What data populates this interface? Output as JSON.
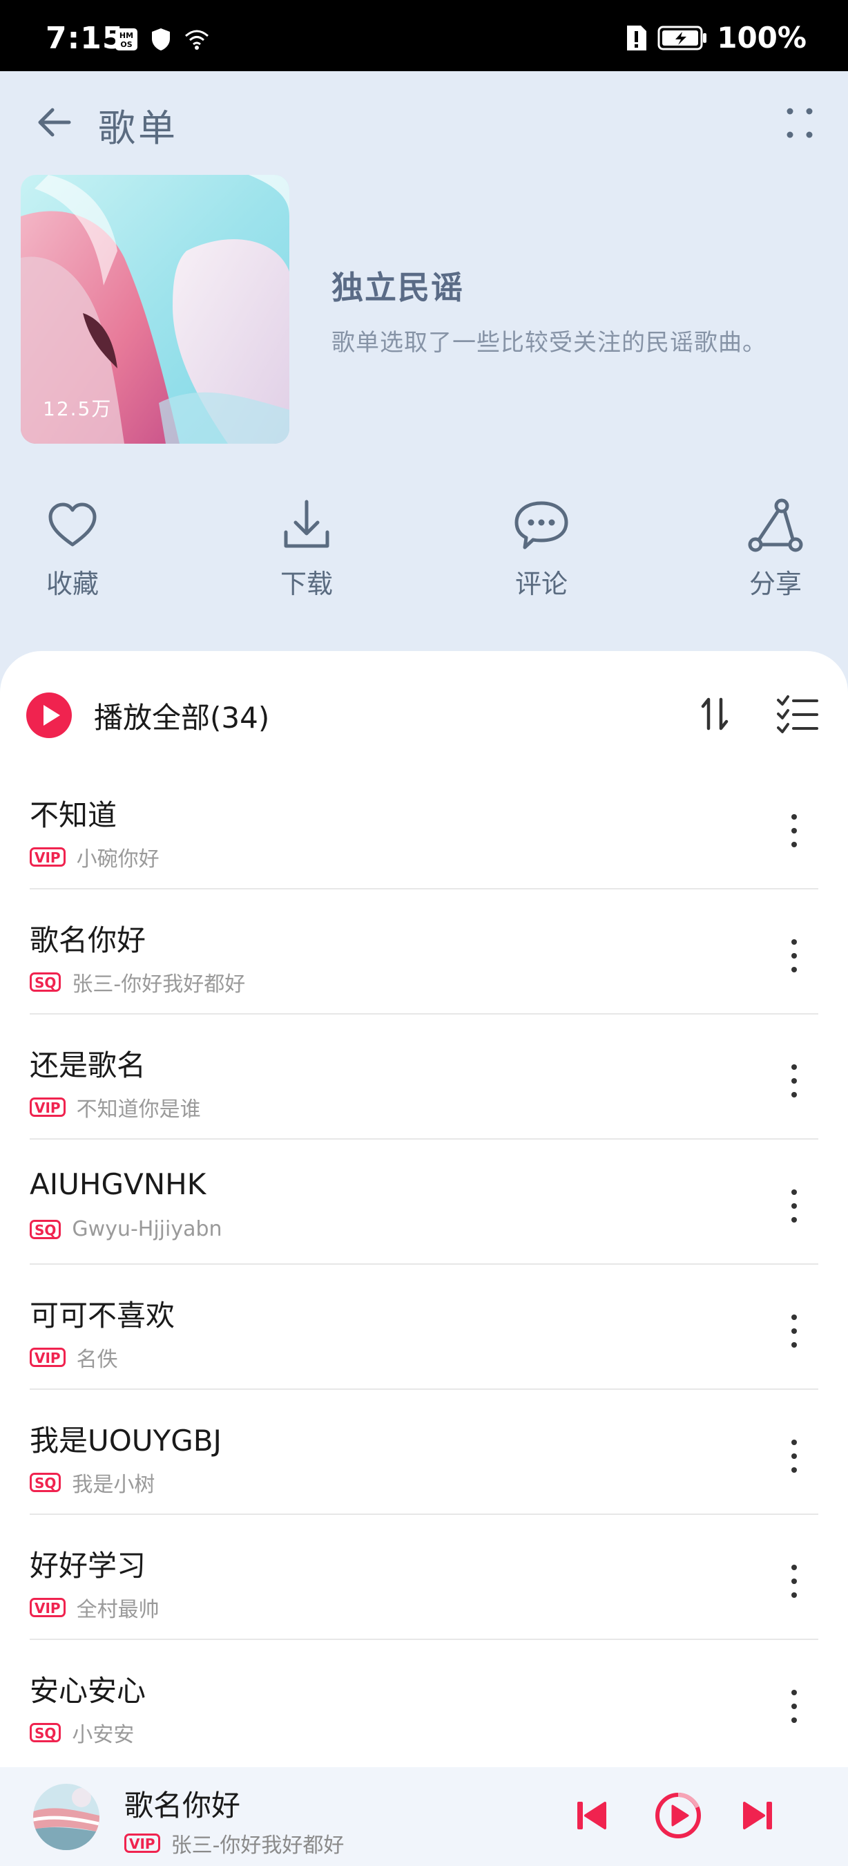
{
  "status_bar": {
    "time": "7:15",
    "battery": "100%"
  },
  "header": {
    "title": "歌单"
  },
  "playlist": {
    "play_count": "12.5万",
    "name": "独立民谣",
    "description": "歌单选取了一些比较受关注的民谣歌曲。"
  },
  "actions": [
    {
      "label": "收藏",
      "icon": "heart-icon"
    },
    {
      "label": "下载",
      "icon": "download-icon"
    },
    {
      "label": "评论",
      "icon": "comment-icon"
    },
    {
      "label": "分享",
      "icon": "share-icon"
    }
  ],
  "play_all": {
    "label": "播放全部(34)"
  },
  "songs": [
    {
      "title": "不知道",
      "badge": "VIP",
      "artist": "小碗你好"
    },
    {
      "title": "歌名你好",
      "badge": "SQ",
      "artist": "张三-你好我好都好"
    },
    {
      "title": "还是歌名",
      "badge": "VIP",
      "artist": "不知道你是谁"
    },
    {
      "title": "AIUHGVNHK",
      "badge": "SQ",
      "artist": "Gwyu-Hjjiyabn"
    },
    {
      "title": "可可不喜欢",
      "badge": "VIP",
      "artist": "名佚"
    },
    {
      "title": "我是UOUYGBJ",
      "badge": "SQ",
      "artist": "我是小树"
    },
    {
      "title": "好好学习",
      "badge": "VIP",
      "artist": "全村最帅"
    },
    {
      "title": "安心安心",
      "badge": "SQ",
      "artist": "小安安"
    }
  ],
  "now_playing": {
    "title": "歌名你好",
    "badge": "VIP",
    "artist": "张三-你好我好都好"
  },
  "colors": {
    "accent": "#f0234f",
    "header_bg": "#e3ebf6",
    "icon": "#5a6b80"
  }
}
